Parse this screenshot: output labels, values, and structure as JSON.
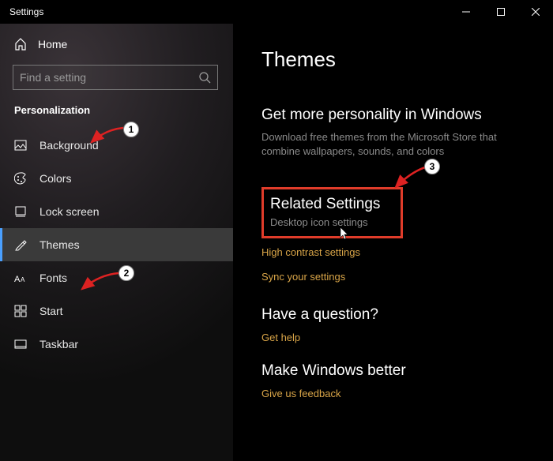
{
  "window": {
    "title": "Settings"
  },
  "sidebar": {
    "home": "Home",
    "search_placeholder": "Find a setting",
    "category": "Personalization",
    "items": [
      {
        "label": "Background",
        "icon": "picture-icon"
      },
      {
        "label": "Colors",
        "icon": "palette-icon"
      },
      {
        "label": "Lock screen",
        "icon": "lockscreen-icon"
      },
      {
        "label": "Themes",
        "icon": "themes-icon",
        "selected": true
      },
      {
        "label": "Fonts",
        "icon": "fonts-icon"
      },
      {
        "label": "Start",
        "icon": "start-icon"
      },
      {
        "label": "Taskbar",
        "icon": "taskbar-icon"
      }
    ]
  },
  "main": {
    "title": "Themes",
    "more": {
      "heading": "Get more personality in Windows",
      "sub": "Download free themes from the Microsoft Store that combine wallpapers, sounds, and colors"
    },
    "related": {
      "heading": "Related Settings",
      "desktop_icon": "Desktop icon settings",
      "high_contrast": "High contrast settings",
      "sync": "Sync your settings"
    },
    "question": {
      "heading": "Have a question?",
      "link": "Get help"
    },
    "better": {
      "heading": "Make Windows better",
      "link": "Give us feedback"
    }
  },
  "annotations": {
    "badge1": "1",
    "badge2": "2",
    "badge3": "3"
  }
}
